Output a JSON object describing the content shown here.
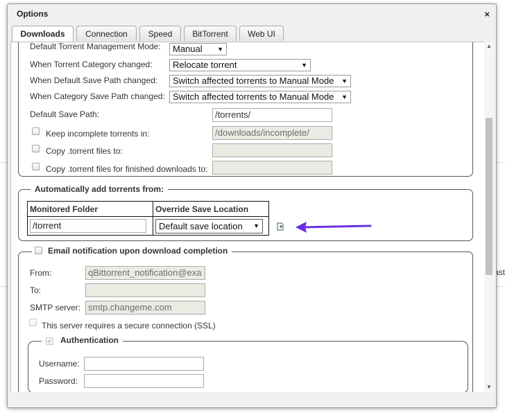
{
  "background": {
    "partial_text": "ast"
  },
  "dialog": {
    "title": "Options",
    "close_symbol": "×"
  },
  "tabs": [
    {
      "label": "Downloads",
      "active": true
    },
    {
      "label": "Connection",
      "active": false
    },
    {
      "label": "Speed",
      "active": false
    },
    {
      "label": "BitTorrent",
      "active": false
    },
    {
      "label": "Web UI",
      "active": false
    }
  ],
  "saving": {
    "management_mode_label": "Default Torrent Management Mode:",
    "management_mode_value": "Manual",
    "category_changed_label": "When Torrent Category changed:",
    "category_changed_value": "Relocate torrent",
    "default_path_changed_label": "When Default Save Path changed:",
    "default_path_changed_value": "Switch affected torrents to Manual Mode",
    "category_path_changed_label": "When Category Save Path changed:",
    "category_path_changed_value": "Switch affected torrents to Manual Mode",
    "default_save_path_label": "Default Save Path:",
    "default_save_path_value": "/torrents/",
    "keep_incomplete_label": "Keep incomplete torrents in:",
    "keep_incomplete_value": "/downloads/incomplete/",
    "copy_torrent_label": "Copy .torrent files to:",
    "copy_torrent_value": "",
    "copy_finished_label": "Copy .torrent files for finished downloads to:",
    "copy_finished_value": ""
  },
  "watched": {
    "legend": "Automatically add torrents from:",
    "col_folder": "Monitored Folder",
    "col_location": "Override Save Location",
    "row_folder": "/torrent",
    "row_location": "Default save location",
    "add_icon": "add-row-icon",
    "annotation_color": "#6a2ee8"
  },
  "email": {
    "legend": "Email notification upon download completion",
    "from_label": "From:",
    "from_value": "qBittorrent_notification@exa",
    "to_label": "To:",
    "to_value": "",
    "smtp_label": "SMTP server:",
    "smtp_value": "smtp.changeme.com",
    "ssl_label": "This server requires a secure connection (SSL)",
    "auth_legend": "Authentication",
    "auth_checked": true,
    "username_label": "Username:",
    "username_value": "",
    "password_label": "Password:",
    "password_value": ""
  },
  "scrollbar": {
    "up_symbol": "▲",
    "down_symbol": "▼"
  }
}
